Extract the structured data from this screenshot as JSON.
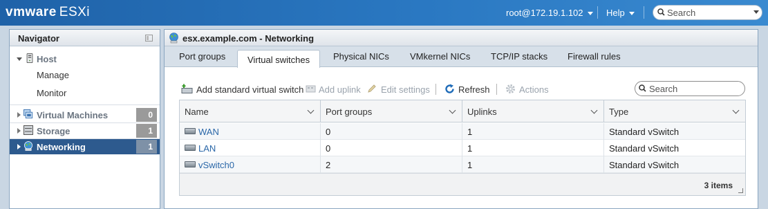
{
  "topbar": {
    "logo_brand": "vmware",
    "logo_product": "ESXi",
    "user": "root@172.19.1.102",
    "help": "Help",
    "search_placeholder": "Search"
  },
  "navigator": {
    "title": "Navigator",
    "host": {
      "label": "Host",
      "children": [
        {
          "label": "Manage"
        },
        {
          "label": "Monitor"
        }
      ]
    },
    "items": [
      {
        "label": "Virtual Machines",
        "count": "0",
        "icon": "vm-icon"
      },
      {
        "label": "Storage",
        "count": "1",
        "icon": "storage-icon"
      },
      {
        "label": "Networking",
        "count": "1",
        "icon": "network-icon",
        "active": true
      }
    ]
  },
  "main": {
    "title": "esx.example.com - Networking",
    "tabs": [
      {
        "label": "Port groups"
      },
      {
        "label": "Virtual switches",
        "active": true
      },
      {
        "label": "Physical NICs"
      },
      {
        "label": "VMkernel NICs"
      },
      {
        "label": "TCP/IP stacks"
      },
      {
        "label": "Firewall rules"
      }
    ],
    "toolbar": {
      "add": "Add standard virtual switch",
      "add_uplink": "Add uplink",
      "edit": "Edit settings",
      "refresh": "Refresh",
      "actions": "Actions",
      "search_placeholder": "Search"
    },
    "grid": {
      "columns": [
        "Name",
        "Port groups",
        "Uplinks",
        "Type"
      ],
      "rows": [
        {
          "name": "WAN",
          "port_groups": "0",
          "uplinks": "1",
          "type": "Standard vSwitch"
        },
        {
          "name": "LAN",
          "port_groups": "0",
          "uplinks": "1",
          "type": "Standard vSwitch"
        },
        {
          "name": "vSwitch0",
          "port_groups": "2",
          "uplinks": "1",
          "type": "Standard vSwitch"
        }
      ],
      "footer": "3 items"
    }
  },
  "colors": {
    "topbar": "#2a78c2",
    "active_nav": "#2d5a8e",
    "link": "#2a67a8"
  }
}
